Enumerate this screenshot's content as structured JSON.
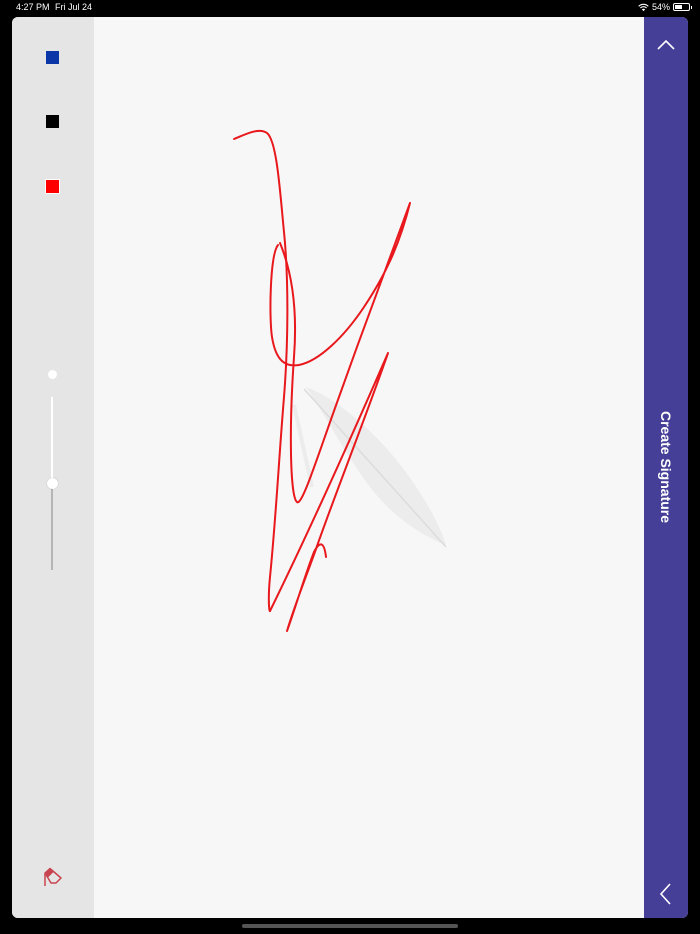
{
  "status_bar": {
    "time": "4:27 PM",
    "date": "Fri Jul 24",
    "battery": "54%",
    "battery_level": 0.54,
    "wifi_icon": "wifi-icon"
  },
  "toolbar": {
    "colors": [
      {
        "name": "blue",
        "hex": "#0b36a8",
        "selected": false
      },
      {
        "name": "black",
        "hex": "#000000",
        "selected": false
      },
      {
        "name": "red",
        "hex": "#ff0000",
        "selected": true
      }
    ],
    "stroke_width_level": 0.5,
    "eraser_icon": "eraser-icon"
  },
  "canvas": {
    "ink_color": "#e8181c",
    "watermark_icon": "feather-icon"
  },
  "side_panel": {
    "title": "Create Signature",
    "background": "#463f98",
    "collapse_icon": "chevron-up-icon",
    "back_icon": "chevron-left-icon"
  }
}
